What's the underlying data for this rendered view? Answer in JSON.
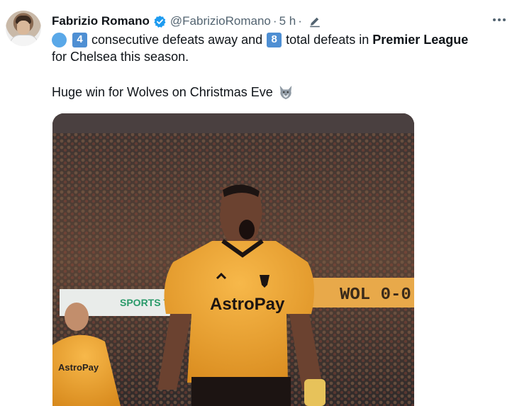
{
  "tweet": {
    "author_name": "Fabrizio Romano",
    "handle": "@FabrizioRomano",
    "separator": "·",
    "time": "5 h",
    "separator2": "·",
    "text": {
      "line1_num_a": "4",
      "line1_part_a": "consecutive defeats away and",
      "line1_num_b": "8",
      "line1_part_b": "total defeats in",
      "line1_bold": "Premier League",
      "line2": "for Chelsea this season.",
      "line3": "Huge win for Wolves on Christmas Eve"
    },
    "media": {
      "jersey_sponsor": "AstroPay",
      "scoreboard": "WOL 0-0",
      "board_text": "SPORTS TUR",
      "secondary_sponsor": "AstroPay"
    }
  },
  "icons": {
    "verified": "verified-badge-icon",
    "edit": "edit-icon",
    "more": "more-icon",
    "wolf": "wolf-emoji-icon"
  },
  "colors": {
    "verified_blue": "#1d9bf0",
    "secondary_text": "#536471",
    "keycap_blue": "#4e8fd3",
    "wolves_gold": "#f2a22e"
  }
}
